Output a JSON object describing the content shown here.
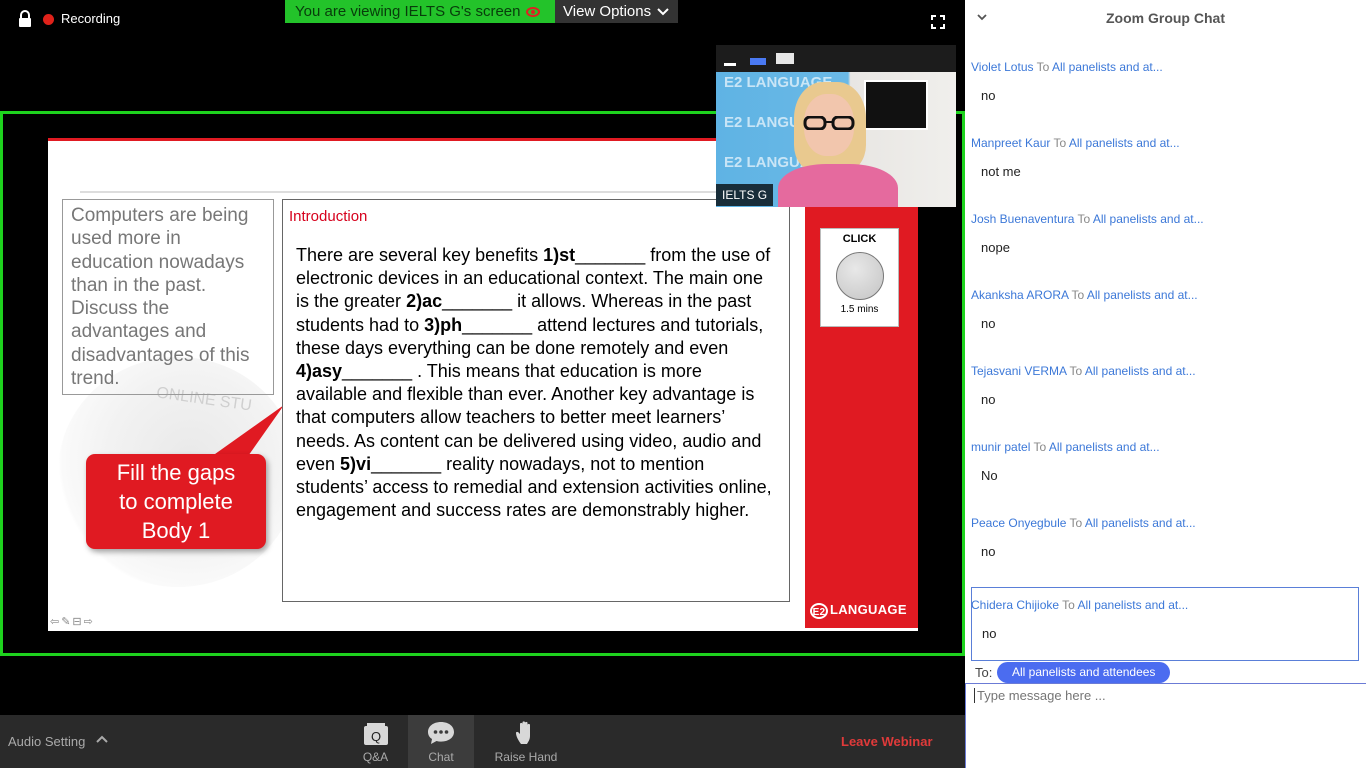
{
  "top_bar": {
    "recording_label": "Recording",
    "viewing_banner": "You are viewing IELTS G's screen",
    "view_options_label": "View Options"
  },
  "slide": {
    "question_text": "Computers are being used more in education nowadays than in the past. Discuss the advantages and disadvantages of this trend.",
    "faded_text": "ONLINE STU",
    "callout_lines": [
      "Fill the gaps",
      "to complete",
      "Body 1"
    ],
    "intro_heading": "Introduction",
    "intro_segments": [
      {
        "text": "There are several key benefits ",
        "bold": false
      },
      {
        "text": "1)st",
        "bold": true
      },
      {
        "text": "_______ from the use of electronic devices in an educational context. The main one is the greater ",
        "bold": false
      },
      {
        "text": "2)ac",
        "bold": true
      },
      {
        "text": "_______ it allows. Whereas in the past students had to ",
        "bold": false
      },
      {
        "text": "3)ph",
        "bold": true
      },
      {
        "text": "_______ attend lectures and tutorials, these days everything can be done remotely and even ",
        "bold": false
      },
      {
        "text": "4)asy",
        "bold": true
      },
      {
        "text": "_______ . This means that education is more available and flexible than ever. Another key advantage is that computers allow teachers to better meet learners’ needs. As content can be delivered using video, audio and even ",
        "bold": false
      },
      {
        "text": "5)vi",
        "bold": true
      },
      {
        "text": "_______ reality nowadays, not to mention students’ access to remedial and extension activities online, engagement and success rates are demonstrably higher.",
        "bold": false
      }
    ],
    "click_label": "CLICK",
    "click_time": "1.5 mins",
    "logo_badge": "E2",
    "logo_text": "LANGUAGE"
  },
  "video": {
    "participant_name": "IELTS G",
    "watermark": "E2 LANGUAGE"
  },
  "chat": {
    "title": "Zoom Group Chat",
    "to_word": "To",
    "messages": [
      {
        "sender": "Violet Lotus",
        "recipient": "All panelists and at...",
        "text": "no"
      },
      {
        "sender": "Manpreet Kaur",
        "recipient": "All panelists and at...",
        "text": "not me"
      },
      {
        "sender": "Josh Buenaventura",
        "recipient": "All panelists and at...",
        "text": "nope"
      },
      {
        "sender": "Akanksha ARORA",
        "recipient": "All panelists and at...",
        "text": "no"
      },
      {
        "sender": "Tejasvani VERMA",
        "recipient": "All panelists and at...",
        "text": "no"
      },
      {
        "sender": "munir patel",
        "recipient": "All panelists and at...",
        "text": "No"
      },
      {
        "sender": "Peace Onyegbule",
        "recipient": "All panelists and at...",
        "text": "no"
      },
      {
        "sender": "Chidera Chijioke",
        "recipient": "All panelists and at...",
        "text": "no"
      }
    ],
    "compose_to_label": "To:",
    "compose_to_value": "All panelists and attendees",
    "compose_placeholder": "Type message here ..."
  },
  "bottom_bar": {
    "audio_setting_label": "Audio Setting",
    "qa_label": "Q&A",
    "chat_label": "Chat",
    "raise_hand_label": "Raise Hand",
    "leave_label": "Leave Webinar"
  },
  "colors": {
    "share_border": "#1ed31e",
    "viewing_banner": "#23c32a",
    "slide_red": "#e01a22",
    "chat_link": "#3c78d8",
    "leave_red": "#e03a3a"
  }
}
